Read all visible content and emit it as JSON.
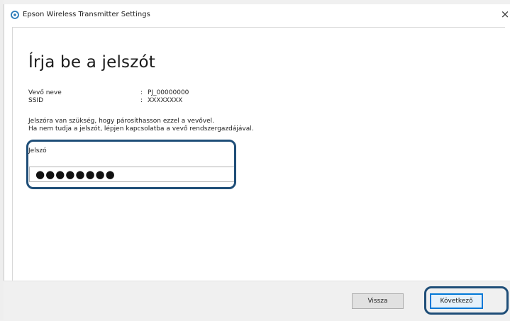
{
  "window": {
    "title": "Epson Wireless Transmitter Settings",
    "close_glyph": "×",
    "icon": "epson-app-icon"
  },
  "page": {
    "heading": "Írja be a jelszót",
    "receiver_name_label": "Vevő neve",
    "receiver_name_sep": ":",
    "receiver_name_value": "PJ_00000000",
    "ssid_label": "SSID",
    "ssid_sep": ":",
    "ssid_value": "XXXXXXXX",
    "message_line1": "Jelszóra van szükség, hogy párosíthasson ezzel a vevővel.",
    "message_line2": "Ha nem tudja a jelszót, lépjen kapcsolatba a vevő rendszergazdájával.",
    "password_label": "Jelszó",
    "password_value": "●●●●●●●●"
  },
  "footer": {
    "back_label": "Vissza",
    "next_label": "Következő"
  },
  "colors": {
    "highlight": "#1f4e78",
    "default_button_border": "#0078d7"
  }
}
